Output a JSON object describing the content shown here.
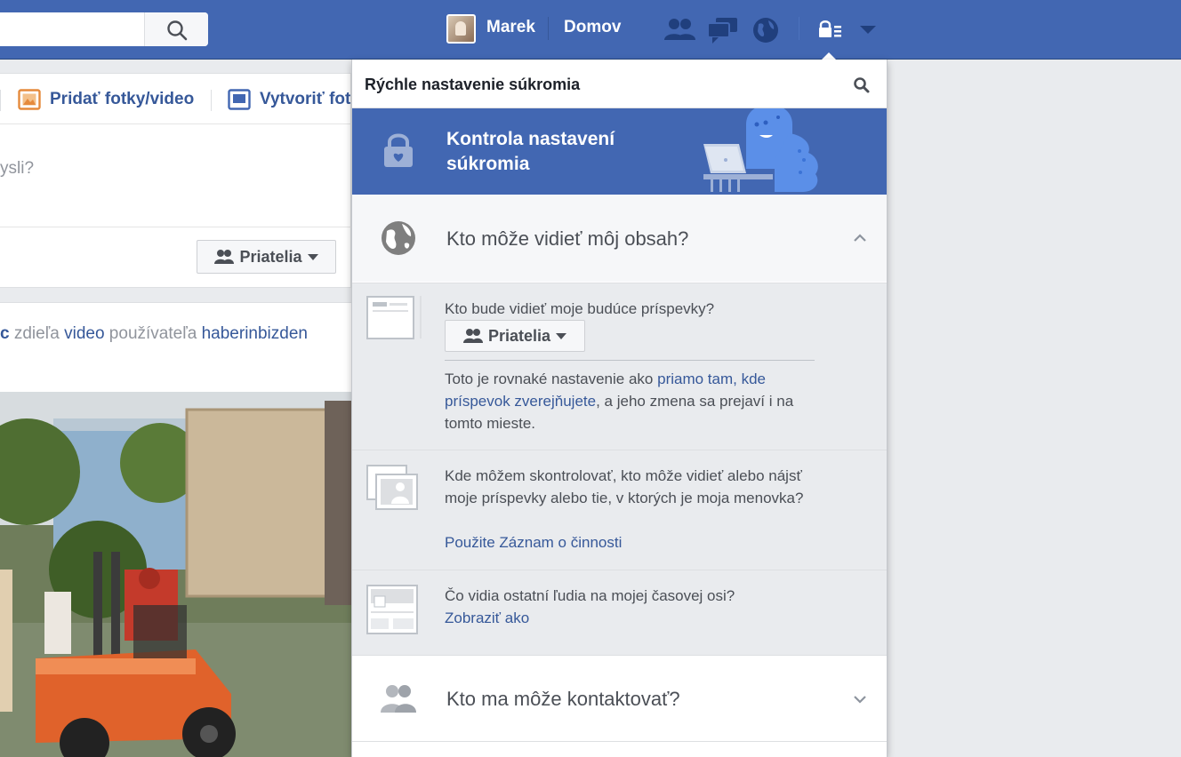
{
  "topbar": {
    "user_name": "Marek",
    "home_label": "Domov",
    "icons": [
      "search-icon",
      "friend-requests-icon",
      "messages-icon",
      "notifications-globe-icon",
      "privacy-shortcuts-icon",
      "account-menu-caret-icon"
    ]
  },
  "composer": {
    "tab_add_photo": "Pridať fotky/video",
    "tab_create": "Vytvoriť fot",
    "prompt": "ysli?",
    "audience_label": "Priatelia"
  },
  "post": {
    "prefix": "c",
    "verb": " zdieľa ",
    "object": "video",
    "mid": " používateľa ",
    "owner": "haberinbizden"
  },
  "privacy_panel": {
    "title": "Rýchle nastavenie súkromia",
    "checkup": {
      "title": "Kontrola nastavení súkromia"
    },
    "who_can_see": {
      "label": "Kto môže vidieť môj obsah?",
      "expanded": true,
      "future_posts": {
        "question": "Kto bude vidieť moje budúce príspevky?",
        "audience": "Priatelia",
        "note_before": "Toto je rovnaké nastavenie ako ",
        "note_link": "priamo tam, kde príspevok zverejňujete",
        "note_after": ", a jeho zmena sa prejaví i na tomto mieste."
      },
      "activity_log": {
        "question": "Kde môžem skontrolovať, kto môže vidieť alebo nájsť moje príspevky alebo tie, v ktorých je moja menovka?",
        "link": "Použite Záznam o činnosti"
      },
      "view_as": {
        "question": "Čo vidia ostatní ľudia na mojej časovej osi?",
        "link": "Zobraziť ako"
      }
    },
    "who_can_contact": {
      "label": "Kto ma môže kontaktovať?",
      "expanded": false
    }
  },
  "colors": {
    "brand_blue": "#4267b2",
    "link_blue": "#365899",
    "panel_gray": "#e9ebee"
  }
}
